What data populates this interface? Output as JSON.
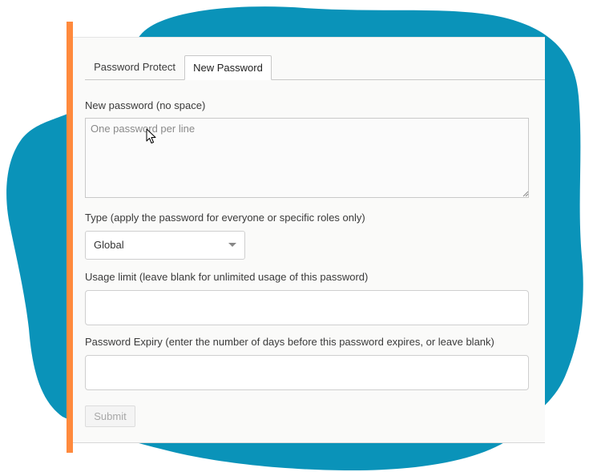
{
  "colors": {
    "background_blob": "#0a93b9",
    "accent_bar": "#ff8a3d",
    "panel": "#fafaf9"
  },
  "tabs": [
    {
      "label": "Password Protect",
      "active": false
    },
    {
      "label": "New Password",
      "active": true
    }
  ],
  "form": {
    "new_password": {
      "label": "New password (no space)",
      "placeholder": "One password per line",
      "value": ""
    },
    "type": {
      "label": "Type (apply the password for everyone or specific roles only)",
      "selected": "Global"
    },
    "usage_limit": {
      "label": "Usage limit (leave blank for unlimited usage of this password)",
      "value": ""
    },
    "expiry": {
      "label": "Password Expiry (enter the number of days before this password expires, or leave blank)",
      "value": ""
    },
    "submit_label": "Submit"
  },
  "icons": {
    "cursor": "mouse-pointer-icon",
    "select_arrow": "caret-down-icon",
    "resize": "resize-grip-icon"
  }
}
